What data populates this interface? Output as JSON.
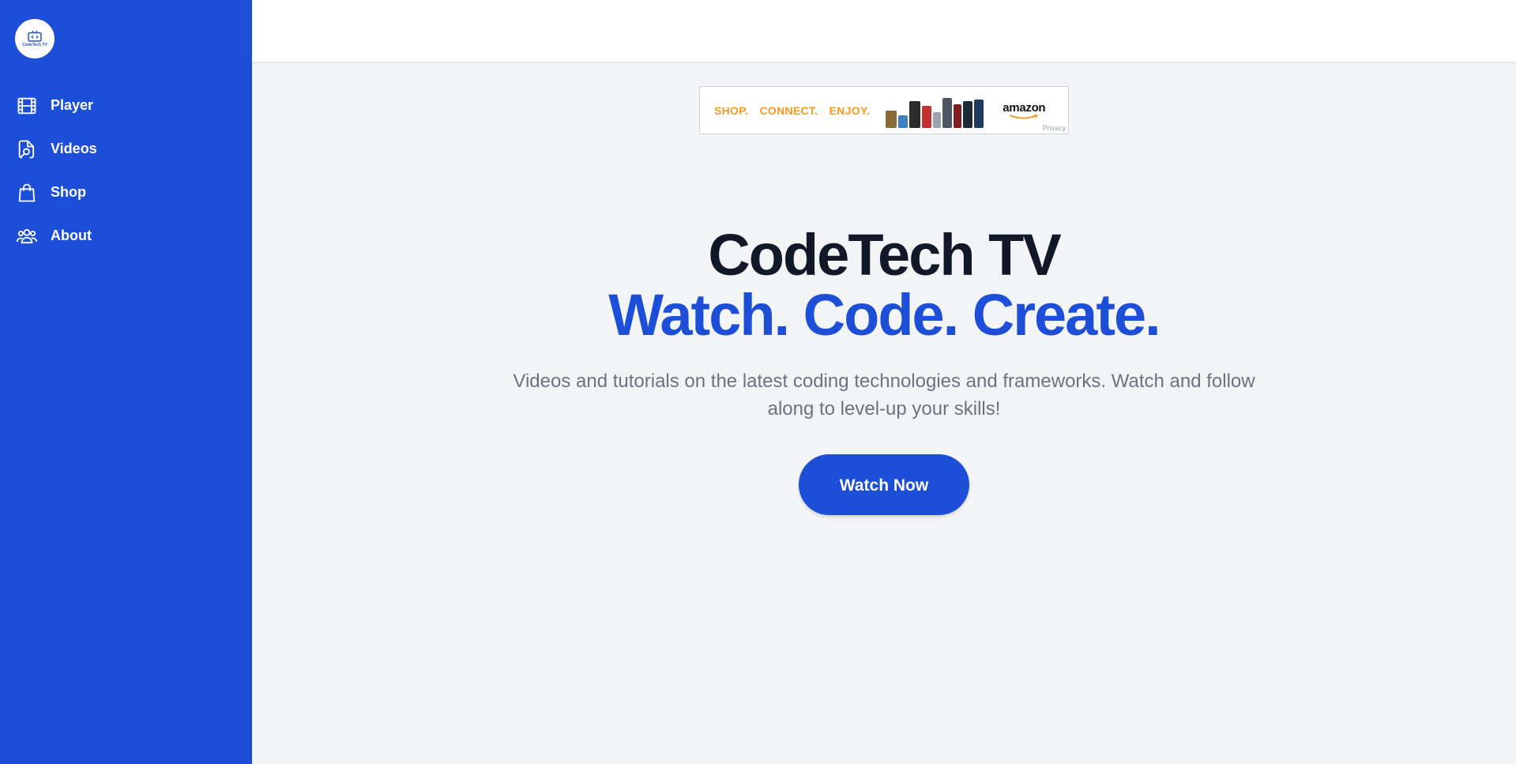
{
  "colors": {
    "sidebar_bg": "#1d4ed8",
    "accent": "#1d4ed8",
    "heading": "#111827",
    "body_text": "#6b7280",
    "page_bg": "#f3f4f6"
  },
  "sidebar": {
    "logo_text": "CodeTech TV",
    "items": [
      {
        "label": "Player",
        "icon": "film-icon"
      },
      {
        "label": "Videos",
        "icon": "document-search-icon"
      },
      {
        "label": "Shop",
        "icon": "shopping-bag-icon"
      },
      {
        "label": "About",
        "icon": "user-group-icon"
      }
    ]
  },
  "ad": {
    "slogan": [
      "SHOP.",
      "CONNECT.",
      "ENJOY."
    ],
    "brand": "amazon",
    "privacy": "Privacy"
  },
  "hero": {
    "title": "CodeTech TV",
    "tagline": "Watch. Code. Create.",
    "description": "Videos and tutorials on the latest coding technologies and frameworks. Watch and follow along to level-up your skills!",
    "button_label": "Watch Now"
  }
}
